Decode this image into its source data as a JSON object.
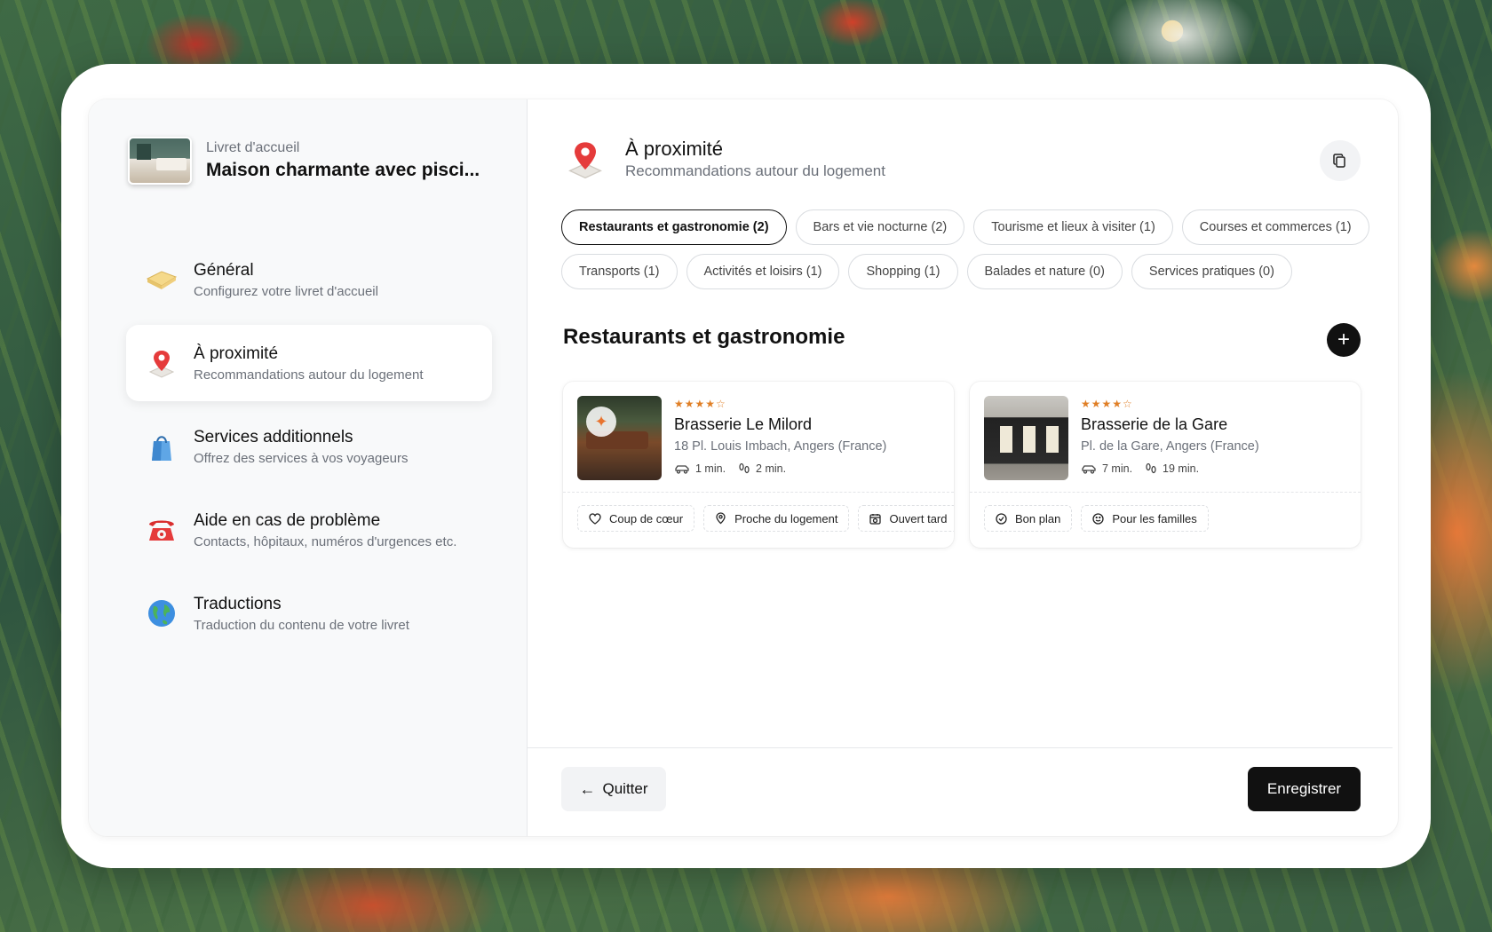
{
  "sidebar": {
    "book_kicker": "Livret d'accueil",
    "book_title": "Maison charmante avec pisci...",
    "items": [
      {
        "title": "Général",
        "subtitle": "Configurez votre livret d'accueil",
        "icon": "book-icon"
      },
      {
        "title": "À proximité",
        "subtitle": "Recommandations autour du logement",
        "icon": "map-pin-icon",
        "active": true
      },
      {
        "title": "Services additionnels",
        "subtitle": "Offrez des services à vos voyageurs",
        "icon": "shopping-bag-icon"
      },
      {
        "title": "Aide en cas de problème",
        "subtitle": "Contacts, hôpitaux, numéros d'urgences etc.",
        "icon": "telephone-icon"
      },
      {
        "title": "Traductions",
        "subtitle": "Traduction du contenu de votre livret",
        "icon": "globe-icon"
      }
    ]
  },
  "header": {
    "title": "À proximité",
    "subtitle": "Recommandations autour du logement"
  },
  "categories": [
    {
      "label": "Restaurants et gastronomie (2)",
      "active": true
    },
    {
      "label": "Bars et vie nocturne (2)"
    },
    {
      "label": "Tourisme et lieux à visiter (1)"
    },
    {
      "label": "Courses et commerces (1)"
    },
    {
      "label": "Transports (1)"
    },
    {
      "label": "Activités et loisirs (1)"
    },
    {
      "label": "Shopping (1)"
    },
    {
      "label": "Balades et nature (0)"
    },
    {
      "label": "Services pratiques (0)"
    }
  ],
  "section_title": "Restaurants et gastronomie",
  "cards": [
    {
      "name": "Brasserie Le Milord",
      "address": "18 Pl. Louis Imbach, Angers (France)",
      "rating": 4,
      "car_time": "1 min.",
      "walk_time": "2 min.",
      "tags": [
        "Coup de cœur",
        "Proche du logement",
        "Ouvert tard"
      ]
    },
    {
      "name": "Brasserie de la Gare",
      "address": "Pl. de la Gare, Angers (France)",
      "rating": 4,
      "car_time": "7 min.",
      "walk_time": "19 min.",
      "tags": [
        "Bon plan",
        "Pour les familles"
      ]
    }
  ],
  "footer": {
    "quit_label": "Quitter",
    "save_label": "Enregistrer"
  },
  "colors": {
    "accent": "#111111",
    "star": "#e07f26"
  }
}
